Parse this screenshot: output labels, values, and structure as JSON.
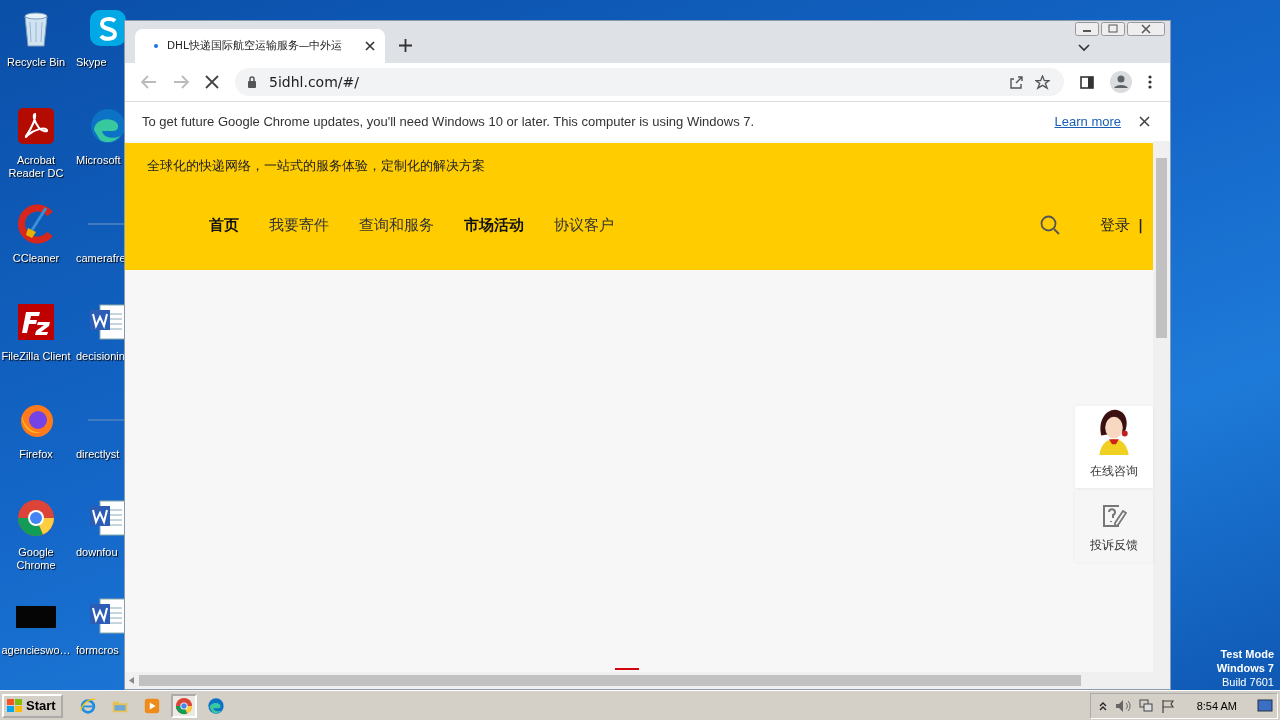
{
  "desktop": {
    "icons": [
      {
        "label": "Recycle Bin",
        "kind": "recycle"
      },
      {
        "label": "Acrobat Reader DC",
        "kind": "acrobat"
      },
      {
        "label": "CCleaner",
        "kind": "ccleaner"
      },
      {
        "label": "FileZilla Client",
        "kind": "filezilla"
      },
      {
        "label": "Firefox",
        "kind": "firefox"
      },
      {
        "label": "Google Chrome",
        "kind": "chrome"
      },
      {
        "label": "agencieswo…",
        "kind": "dark"
      },
      {
        "label": "Skype",
        "kind": "skype"
      },
      {
        "label": "Microsoft",
        "kind": "edge"
      },
      {
        "label": "camerafre",
        "kind": "blank"
      },
      {
        "label": "decisionin",
        "kind": "word"
      },
      {
        "label": "directlyst",
        "kind": "blank"
      },
      {
        "label": "downfou",
        "kind": "word"
      },
      {
        "label": "formcros",
        "kind": "word"
      }
    ],
    "notice": [
      "Test Mode",
      "Windows 7",
      "Build 7601"
    ]
  },
  "browser": {
    "tab": {
      "title": "DHL快递国际航空运输服务—中外运",
      "loading": true
    },
    "address": "5idhl.com/#/",
    "infobar": {
      "message": "To get future Google Chrome updates, you'll need Windows 10 or later. This computer is using Windows 7.",
      "link": "Learn more"
    },
    "page": {
      "tagline": "全球化的快递网络，一站式的服务体验，定制化的解决方案",
      "nav": [
        "首页",
        "我要寄件",
        "查询和服务",
        "市场活动",
        "协议客户"
      ],
      "login": "登录",
      "separator": "|",
      "side_panel": [
        {
          "label": "在线咨询",
          "kind": "agent"
        },
        {
          "label": "投诉反馈",
          "kind": "feedback"
        }
      ]
    }
  },
  "taskbar": {
    "start": "Start",
    "apps": [
      {
        "kind": "ie",
        "selected": false
      },
      {
        "kind": "folder",
        "selected": false
      },
      {
        "kind": "media",
        "selected": false
      },
      {
        "kind": "chrome",
        "selected": true
      },
      {
        "kind": "edge",
        "selected": false
      }
    ],
    "clock": "8:54 AM"
  }
}
